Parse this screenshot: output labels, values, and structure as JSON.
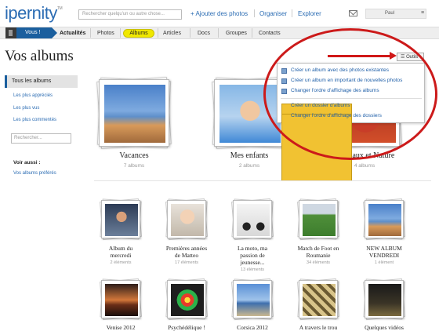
{
  "header": {
    "logo": "ipernity",
    "logo_tm": "TM",
    "search_placeholder": "Rechercher quelqu'un ou autre chose...",
    "nav": [
      "+ Ajouter des photos",
      "Organiser",
      "Explorer"
    ],
    "username": "Paul",
    "user_menu_icon": "menu-icon"
  },
  "tabs": {
    "vous": "Vous !",
    "items": [
      "Actualités",
      "Photos",
      "Albums",
      "Articles",
      "Docs",
      "Groupes",
      "Contacts"
    ],
    "active": "Albums"
  },
  "page": {
    "title": "Vos albums",
    "tools_label": "Outils"
  },
  "tools_menu": {
    "items": [
      "Créer un album avec des photos existantes",
      "Créer un album en important de nouvelles photos",
      "Changer l'ordre d'affichage des albums",
      "Créer un dossier d'albums",
      "Changer l'ordre d'affichage des dossiers"
    ]
  },
  "sidebar": {
    "active": "Tous les albums",
    "links": [
      "Les plus appréciés",
      "Les plus vus",
      "Les plus commentés"
    ],
    "search_placeholder": "Rechercher...",
    "see_also_title": "Voir aussi :",
    "see_also_link": "Vos albums préférés"
  },
  "folders": [
    {
      "title": "Vacances",
      "count": "7 albums"
    },
    {
      "title": "Mes enfants",
      "count": "2 albums"
    },
    {
      "title": "Animaux et Nature",
      "count": "4 albums"
    }
  ],
  "albums_row1": [
    {
      "title_lines": [
        "Album du",
        "mercredi"
      ],
      "count": "2 éléments"
    },
    {
      "title_lines": [
        "Premières années",
        "de Matteo"
      ],
      "count": "17 éléments"
    },
    {
      "title_lines": [
        "La moto, ma",
        "passion de",
        "jeunesse..."
      ],
      "count": "13 éléments"
    },
    {
      "title_lines": [
        "Match de Foot en",
        "Roumanie"
      ],
      "count": "34 éléments"
    },
    {
      "title_lines": [
        "NEW ALBUM",
        "VENDREDI"
      ],
      "count": "1 élément"
    }
  ],
  "albums_row2": [
    {
      "title": "Venise 2012"
    },
    {
      "title": "Psychédélique !"
    },
    {
      "title": "Corsica 2012"
    },
    {
      "title": "A travers le trou"
    },
    {
      "title": "Quelques vidéos"
    }
  ],
  "colors": {
    "accent": "#1b5f9e",
    "link": "#2b6cb3",
    "active_tab": "#f0e800",
    "annotation_red": "#cc1a1a"
  }
}
